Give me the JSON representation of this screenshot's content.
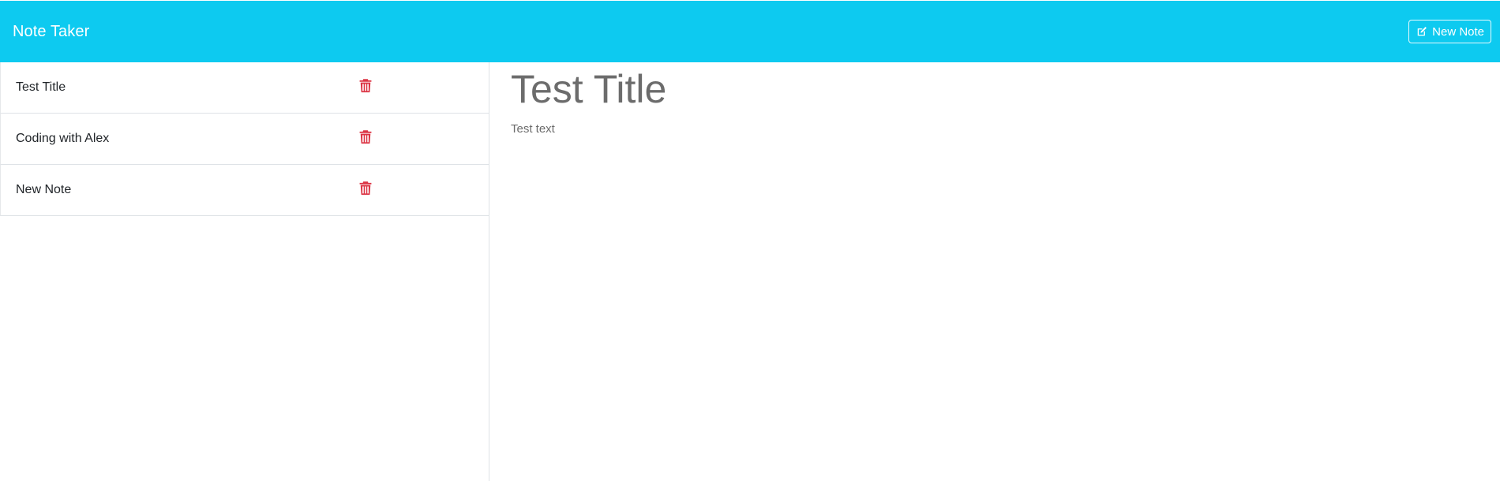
{
  "header": {
    "brand": "Note Taker",
    "new_note_label": "New Note",
    "new_note_icon": "pencil-square-icon",
    "background_color": "#0dcaf0"
  },
  "sidebar": {
    "notes": [
      {
        "title": "Test Title",
        "delete_icon": "trash-icon"
      },
      {
        "title": "Coding with Alex",
        "delete_icon": "trash-icon"
      },
      {
        "title": "New Note",
        "delete_icon": "trash-icon"
      }
    ],
    "delete_icon_color": "#dc3545"
  },
  "editor": {
    "title": "Test Title",
    "text": "Test text"
  }
}
